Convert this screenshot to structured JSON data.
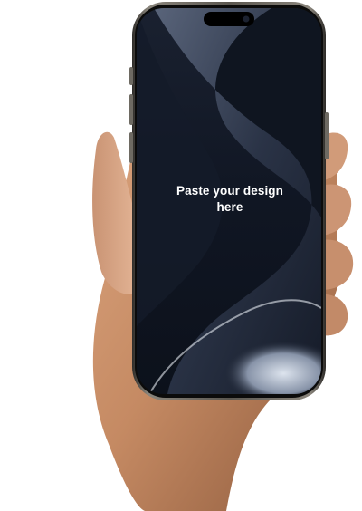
{
  "screen": {
    "placeholder_line1": "Paste your design",
    "placeholder_line2": "here"
  },
  "colors": {
    "background": "#ffffff",
    "skin": "#c98d68",
    "skin_shadow": "#8d5a3c",
    "frame": "#4a4640",
    "bezel": "#0b0b0b",
    "wallpaper_dark": "#141a26",
    "wallpaper_light": "#c9d2de",
    "text": "#ffffff"
  }
}
